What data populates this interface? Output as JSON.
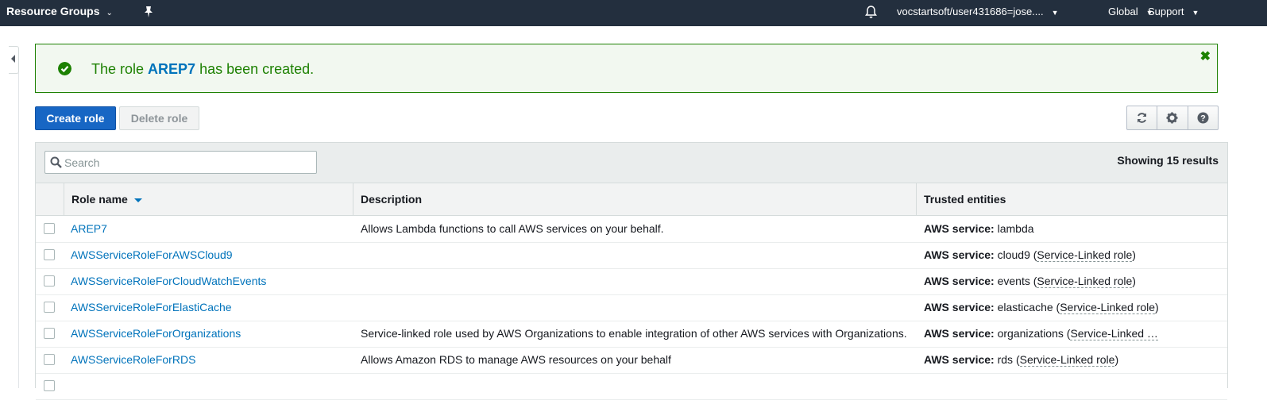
{
  "topnav": {
    "resource_groups": "Resource Groups",
    "account": "vocstartsoft/user431686=jose....",
    "region": "Global",
    "support": "Support"
  },
  "flash": {
    "prefix": "The role ",
    "role": "AREP7",
    "suffix": " has been created."
  },
  "toolbar": {
    "create_label": "Create role",
    "delete_label": "Delete role"
  },
  "search": {
    "placeholder": "Search"
  },
  "results": "Showing 15 results",
  "columns": {
    "name": "Role name",
    "description": "Description",
    "trusted": "Trusted entities"
  },
  "trusted_prefix": "AWS service:",
  "rows": [
    {
      "name": "AREP7",
      "description": "Allows Lambda functions to call AWS services on your behalf.",
      "service": " lambda",
      "linked": ""
    },
    {
      "name": "AWSServiceRoleForAWSCloud9",
      "description": "",
      "service": " cloud9 (",
      "linked": "Service-Linked role",
      "close": ")"
    },
    {
      "name": "AWSServiceRoleForCloudWatchEvents",
      "description": "",
      "service": " events (",
      "linked": "Service-Linked role",
      "close": ")"
    },
    {
      "name": "AWSServiceRoleForElastiCache",
      "description": "",
      "service": " elasticache (",
      "linked": "Service-Linked role",
      "close": ")"
    },
    {
      "name": "AWSServiceRoleForOrganizations",
      "description": "Service-linked role used by AWS Organizations to enable integration of other AWS services with Organizations.",
      "service": " organizations (",
      "linked": "Service-Linked …",
      "close": ""
    },
    {
      "name": "AWSServiceRoleForRDS",
      "description": "Allows Amazon RDS to manage AWS resources on your behalf",
      "service": " rds (",
      "linked": "Service-Linked role",
      "close": ")"
    }
  ],
  "colors": {
    "nav": "#232f3e",
    "link": "#0073bb",
    "success": "#1d8102",
    "primary": "#1766c4"
  }
}
